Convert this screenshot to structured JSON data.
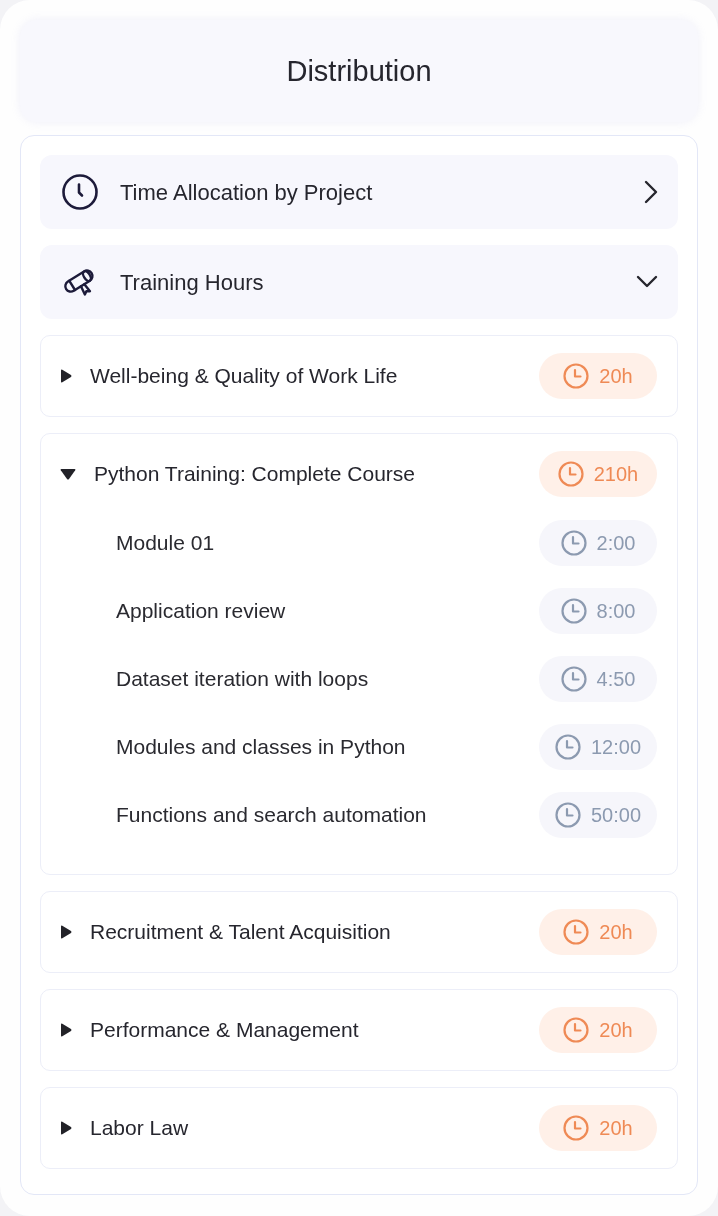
{
  "header": {
    "title": "Distribution"
  },
  "sections": [
    {
      "label": "Time Allocation by Project",
      "expanded": false
    },
    {
      "label": "Training Hours",
      "expanded": true,
      "children": [
        {
          "title": "Well-being & Quality of Work Life",
          "hours": "20h",
          "expanded": false
        },
        {
          "title": "Python Training: Complete Course",
          "hours": "210h",
          "expanded": true,
          "children": [
            {
              "title": "Module 01",
              "duration": "2:00"
            },
            {
              "title": "Application review",
              "duration": "8:00"
            },
            {
              "title": "Dataset iteration with loops",
              "duration": "4:50"
            },
            {
              "title": "Modules and classes in Python",
              "duration": "12:00"
            },
            {
              "title": "Functions and search automation",
              "duration": "50:00"
            }
          ]
        },
        {
          "title": "Recruitment & Talent Acquisition",
          "hours": "20h",
          "expanded": false
        },
        {
          "title": "Performance & Management",
          "hours": "20h",
          "expanded": false
        },
        {
          "title": "Labor Law",
          "hours": "20h",
          "expanded": false
        }
      ]
    }
  ]
}
